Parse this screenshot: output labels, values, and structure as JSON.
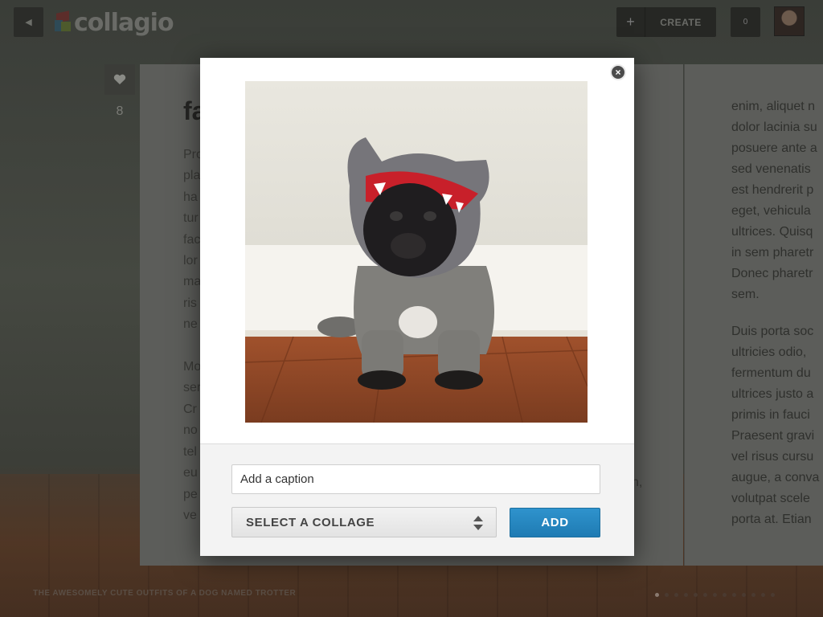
{
  "app": {
    "logo_text": "collagio",
    "back_icon": "back-arrow-icon"
  },
  "header": {
    "create_label": "CREATE",
    "notification_count": "0"
  },
  "article": {
    "like_count": "8",
    "title_fragment": "fa",
    "left_fragments": [
      "Pro",
      "pla",
      "ha",
      "tur",
      "fac",
      "lor",
      "ma",
      "ris",
      "ne",
      "",
      "Mo",
      "ser",
      "Cr",
      "no",
      "tel",
      "eu",
      "pe",
      "ve"
    ],
    "left_tail": "n,",
    "right_paragraph_1": [
      "enim, aliquet n",
      "dolor lacinia su",
      "posuere ante a",
      "sed venenatis",
      "est hendrerit p",
      "eget, vehicula",
      "ultrices. Quisq",
      "in sem pharetr",
      "Donec pharetr",
      "sem."
    ],
    "right_paragraph_2": [
      "Duis porta soc",
      "ultricies odio,",
      "fermentum du",
      "ultrices justo a",
      "primis in fauci",
      "Praesent gravi",
      "vel risus cursu",
      "augue, a conva",
      "volutpat scele",
      "porta at. Etian"
    ]
  },
  "footer": {
    "caption": "THE AWESOMELY CUTE OUTFITS OF A DOG NAMED TROTTER",
    "page_dots": 13,
    "active_dot": 0
  },
  "modal": {
    "close_icon": "close-icon",
    "caption_placeholder": "Add a caption",
    "caption_value": "",
    "select_label": "SELECT A COLLAGE",
    "add_label": "ADD"
  }
}
